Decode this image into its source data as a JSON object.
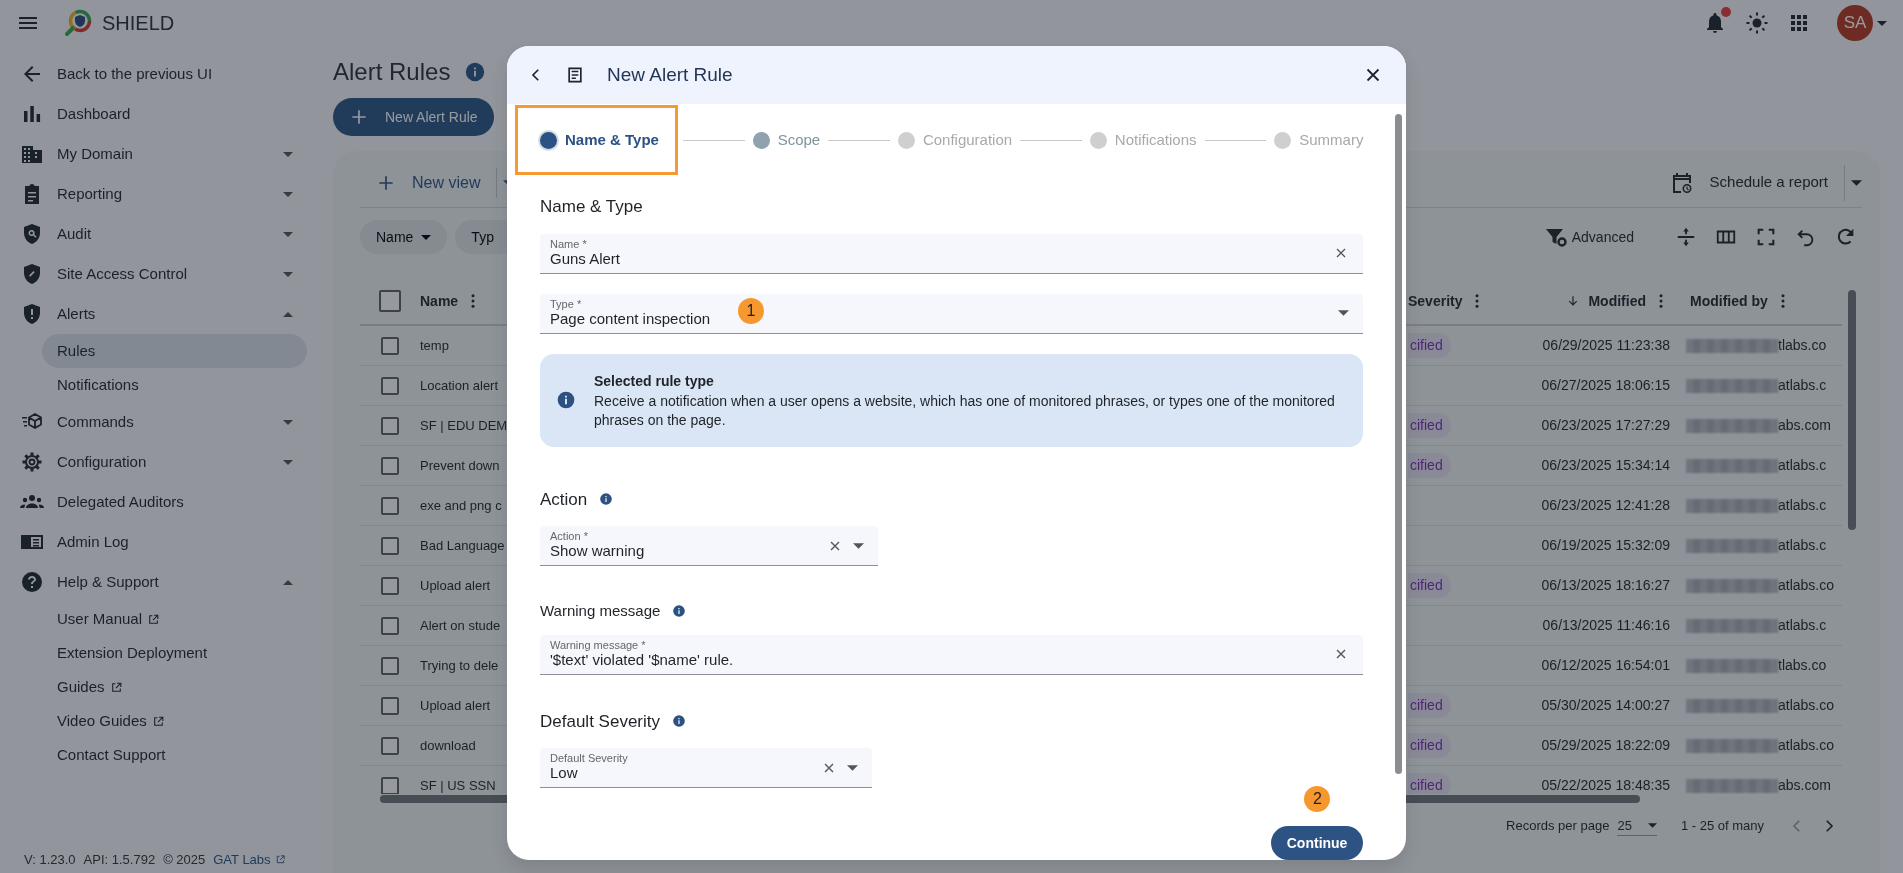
{
  "header": {
    "app_name": "SHIELD",
    "has_notifications": true,
    "avatar_initials": "SA"
  },
  "sidebar": {
    "items": [
      {
        "label": "Back to the previous UI",
        "selected": false
      },
      {
        "label": "Dashboard",
        "selected": false
      },
      {
        "label": "My Domain",
        "selected": false,
        "expanded": false
      },
      {
        "label": "Reporting",
        "selected": false,
        "expanded": false
      },
      {
        "label": "Audit",
        "selected": false,
        "expanded": false
      },
      {
        "label": "Site Access Control",
        "selected": false,
        "expanded": false
      },
      {
        "label": "Alerts",
        "selected": false,
        "expanded": true,
        "children": [
          {
            "label": "Rules",
            "selected": true,
            "external": false
          },
          {
            "label": "Notifications",
            "selected": false,
            "external": false
          }
        ]
      },
      {
        "label": "Commands",
        "selected": false,
        "expanded": false
      },
      {
        "label": "Configuration",
        "selected": false,
        "expanded": false
      },
      {
        "label": "Delegated Auditors",
        "selected": false
      },
      {
        "label": "Admin Log",
        "selected": false
      },
      {
        "label": "Help & Support",
        "selected": false,
        "expanded": true,
        "children": [
          {
            "label": "User Manual",
            "selected": false,
            "external": true
          },
          {
            "label": "Extension Deployment",
            "selected": false,
            "external": false
          },
          {
            "label": "Guides",
            "selected": false,
            "external": true
          },
          {
            "label": "Video Guides",
            "selected": false,
            "external": true
          },
          {
            "label": "Contact Support",
            "selected": false,
            "external": false
          }
        ]
      }
    ],
    "footer": {
      "version": "V: 1.23.0",
      "api": "API: 1.5.792",
      "copyright": "© 2025",
      "link": "GAT Labs"
    }
  },
  "page": {
    "title": "Alert Rules",
    "primary_button": "New Alert Rule"
  },
  "toolbar": {
    "new_view": "New view",
    "schedule": "Schedule a report",
    "filters": [
      "Name",
      "Typ"
    ],
    "advanced": "Advanced"
  },
  "table": {
    "all_selected": false,
    "columns": [
      {
        "label": "Name"
      },
      {
        "label": "Severity"
      },
      {
        "label": "Modified",
        "sorted": true
      },
      {
        "label": "Modified by"
      }
    ],
    "rows": [
      {
        "selected": false,
        "name": "temp",
        "severity": "cified",
        "modified": "06/29/2025 11:23:38",
        "modified_by": "tlabs.co"
      },
      {
        "selected": false,
        "name": "Location alert",
        "modified": "06/27/2025 18:06:15",
        "modified_by": "atlabs.c"
      },
      {
        "selected": false,
        "name": "SF | EDU DEM",
        "severity": "cified",
        "modified": "06/23/2025 17:27:29",
        "modified_by": "abs.com"
      },
      {
        "selected": false,
        "name": "Prevent down",
        "severity": "cified",
        "modified": "06/23/2025 15:34:14",
        "modified_by": "atlabs.c"
      },
      {
        "selected": false,
        "name": "exe and png c",
        "modified": "06/23/2025 12:41:28",
        "modified_by": "atlabs.c"
      },
      {
        "selected": false,
        "name": "Bad Language",
        "modified": "06/19/2025 15:32:09",
        "modified_by": "atlabs.c"
      },
      {
        "selected": false,
        "name": "Upload alert",
        "severity": "cified",
        "modified": "06/13/2025 18:16:27",
        "modified_by": "atlabs.co"
      },
      {
        "selected": false,
        "name": "Alert on stude",
        "modified": "06/13/2025 11:46:16",
        "modified_by": "atlabs.c"
      },
      {
        "selected": false,
        "name": "Trying to dele",
        "modified": "06/12/2025 16:54:01",
        "modified_by": "tlabs.co"
      },
      {
        "selected": false,
        "name": "Upload alert",
        "severity": "cified",
        "modified": "05/30/2025 14:00:27",
        "modified_by": "atlabs.co"
      },
      {
        "selected": false,
        "name": "download",
        "severity": "cified",
        "modified": "05/29/2025 18:22:09",
        "modified_by": "atlabs.co"
      },
      {
        "selected": false,
        "name": "SF | US SSN",
        "severity": "cified",
        "modified": "05/22/2025 18:48:35",
        "modified_by": "abs.com"
      }
    ]
  },
  "pagination": {
    "label": "Records per page",
    "per_page": "25",
    "range": "1 - 25 of many"
  },
  "dialog": {
    "title": "New Alert Rule",
    "steps": [
      {
        "label": "Name & Type",
        "selected": true,
        "disabled": false,
        "highlighted": true
      },
      {
        "label": "Scope",
        "selected": false,
        "disabled": false,
        "highlighted": false
      },
      {
        "label": "Configuration",
        "selected": false,
        "disabled": true,
        "highlighted": false
      },
      {
        "label": "Notifications",
        "selected": false,
        "disabled": true,
        "highlighted": false
      },
      {
        "label": "Summary",
        "selected": false,
        "disabled": true,
        "highlighted": false
      }
    ],
    "blocks": [
      {
        "kind": "heading",
        "text": "Name & Type",
        "info": false
      },
      {
        "kind": "text",
        "label": "Name *",
        "value": "Guns Alert",
        "clearable": true
      },
      {
        "kind": "select",
        "label": "Type *",
        "value": "Page content inspection",
        "clearable": false,
        "marker": "1"
      },
      {
        "kind": "info",
        "title": "Selected rule type",
        "text": "Receive a notification when a user opens a website, which has one of monitored phrases, or types one of the monitored phrases on the page."
      },
      {
        "kind": "heading",
        "text": "Action",
        "info": true
      },
      {
        "kind": "select",
        "label": "Action *",
        "value": "Show warning",
        "clearable": true
      },
      {
        "kind": "subheading",
        "text": "Warning message",
        "info": true
      },
      {
        "kind": "text",
        "label": "Warning message *",
        "value": "'$text' violated '$name' rule.",
        "clearable": true
      },
      {
        "kind": "heading",
        "text": "Default Severity",
        "info": true
      },
      {
        "kind": "select",
        "label": "Default Severity",
        "value": "Low",
        "clearable": true
      }
    ],
    "button": {
      "label": "Continue",
      "marker": "2"
    }
  }
}
